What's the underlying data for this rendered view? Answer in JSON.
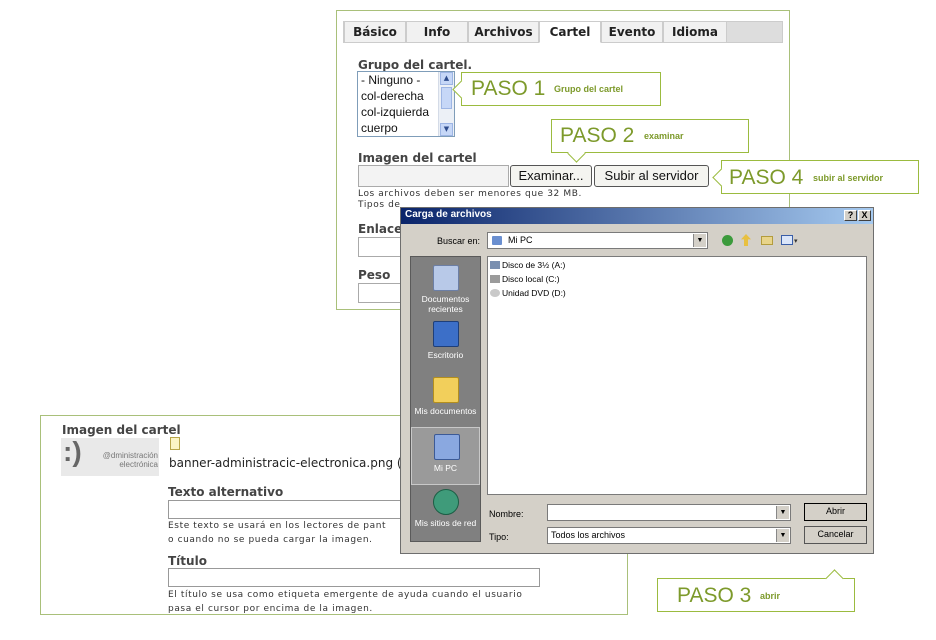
{
  "tabs": [
    "Básico",
    "Info",
    "Archivos",
    "Cartel",
    "Evento",
    "Idioma"
  ],
  "top_form": {
    "group_label": "Grupo del cartel.",
    "group_options": [
      "- Ninguno -",
      "col-derecha",
      "col-izquierda",
      "cuerpo"
    ],
    "image_label": "Imagen del cartel",
    "examine_button": "Examinar...",
    "upload_button": "Subir al servidor",
    "help_line1": "Los archivos deben ser menores que 32 MB.",
    "help_line2": "Tipos de",
    "link_label": "Enlace",
    "weight_label": "Peso"
  },
  "callouts": {
    "paso1": {
      "title": "PASO 1",
      "hint": "Grupo del cartel"
    },
    "paso2": {
      "title": "PASO 2",
      "hint": "examinar"
    },
    "paso3": {
      "title": "PASO 3",
      "hint": "abrir"
    },
    "paso4": {
      "title": "PASO 4",
      "hint": "subir al servidor"
    }
  },
  "bottom_form": {
    "image_label": "Imagen del cartel",
    "logo_text": "@dministración electrónica",
    "filename": "banner-administracic-electronica.png (",
    "alt_label": "Texto alternativo",
    "alt_help1": "Este texto se usará en los lectores de pant",
    "alt_help2": "o cuando no se pueda cargar la imagen.",
    "title_label": "Título",
    "title_help1": "El título se usa como etiqueta emergente de ayuda cuando el usuario",
    "title_help2": "pasa el cursor por encima de la imagen."
  },
  "dialog": {
    "title": "Carga de archivos",
    "help_btn": "?",
    "close_btn": "X",
    "lookin_label": "Buscar en:",
    "lookin_value": "Mi PC",
    "places": [
      "Documentos recientes",
      "Escritorio",
      "Mis documentos",
      "Mi PC",
      "Mis sitios de red"
    ],
    "selected_place": "Mi PC",
    "files": [
      "Disco de 3½ (A:)",
      "Disco local (C:)",
      "Unidad DVD (D:)"
    ],
    "name_label": "Nombre:",
    "name_value": "",
    "type_label": "Tipo:",
    "type_value": "Todos los archivos",
    "open_button": "Abrir",
    "cancel_button": "Cancelar"
  },
  "colors": {
    "accent_green": "#7d9a2b",
    "titlebar": "#0a246a"
  }
}
